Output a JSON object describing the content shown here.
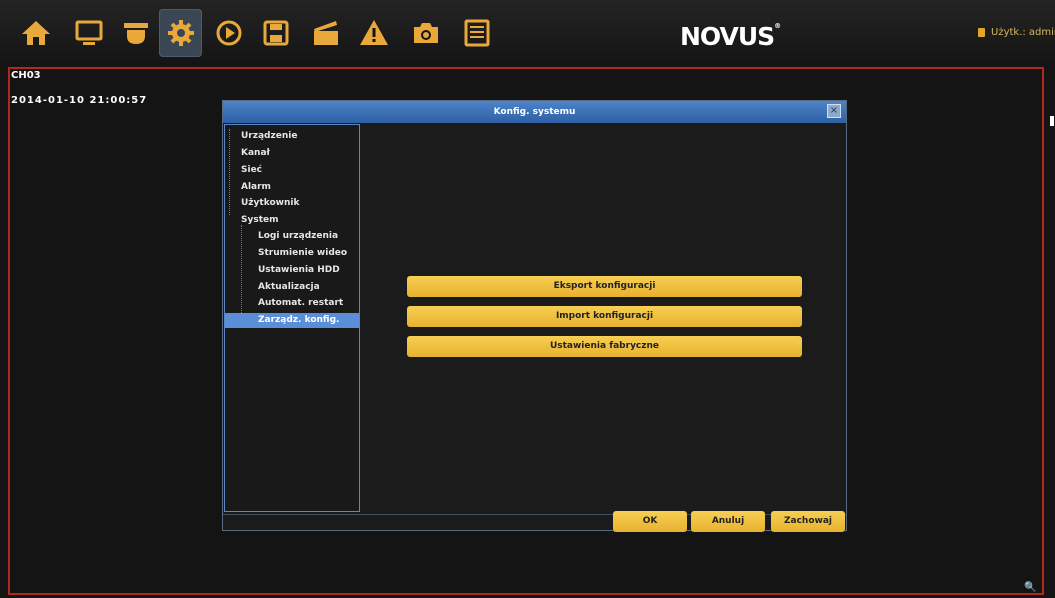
{
  "toolbar": {
    "icons": [
      "home-icon",
      "monitor-icon",
      "camera-icon",
      "gear-icon",
      "play-icon",
      "save-icon",
      "clapperboard-icon",
      "warning-icon",
      "snapshot-icon",
      "list-icon"
    ],
    "accent": "#e8a93a",
    "active_index": 3
  },
  "brand": {
    "logo_text": "NOVUS",
    "reg_mark": "®"
  },
  "user": {
    "label": "Użytk.: admin",
    "icon": "lock-icon"
  },
  "channel": {
    "name": "CH03",
    "datetime": "2014-01-10  21:00:57"
  },
  "dialog": {
    "title": "Konfig. systemu",
    "close_label": "×",
    "tree": {
      "items": [
        {
          "label": "Urządzenie"
        },
        {
          "label": "Kanał"
        },
        {
          "label": "Sieć"
        },
        {
          "label": "Alarm"
        },
        {
          "label": "Użytkownik"
        },
        {
          "label": "System"
        }
      ],
      "sub_items": [
        {
          "label": "Logi urządzenia"
        },
        {
          "label": "Strumienie wideo"
        },
        {
          "label": "Ustawienia HDD"
        },
        {
          "label": "Aktualizacja"
        },
        {
          "label": "Automat. restart"
        },
        {
          "label": "Zarządz. konfig."
        }
      ],
      "selected": "Zarządz. konfig."
    },
    "actions": {
      "export": "Eksport konfiguracji",
      "import": "Import konfiguracji",
      "factory": "Ustawienia fabryczne"
    },
    "footer": {
      "ok": "OK",
      "cancel": "Anuluj",
      "save": "Zachowaj"
    }
  },
  "colors": {
    "border_red": "#b3281d",
    "title_blue": "#3d72b8",
    "button_yellow": "#f2c443"
  }
}
